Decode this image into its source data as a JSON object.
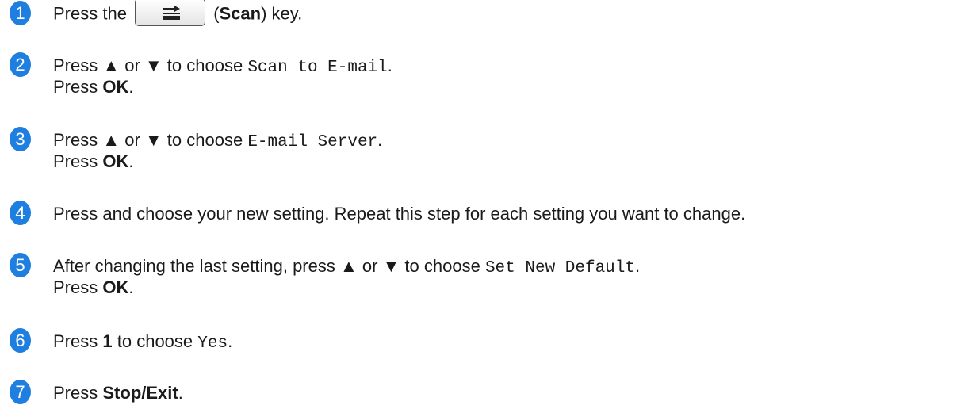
{
  "steps": [
    {
      "number": "1",
      "press_prefix": "Press the",
      "key_name": "Scan",
      "key_suffix": ") key.",
      "open_paren": "(",
      "key_icon": "scan-key-icon"
    },
    {
      "number": "2",
      "line1_prefix": "Press ▲ or ▼ to choose",
      "menu_item": "Scan to E-mail",
      "period": ".",
      "line2_prefix": "Press",
      "key": "OK",
      "line2_suffix": "."
    },
    {
      "number": "3",
      "line1_prefix": "Press ▲ or ▼ to choose",
      "menu_item": "E-mail Server",
      "period": ".",
      "line2_prefix": "Press",
      "key": "OK",
      "line2_suffix": "."
    },
    {
      "number": "4",
      "text": "Press and choose your new setting. Repeat this step for each setting you want to change."
    },
    {
      "number": "5",
      "line1_prefix": "After changing the last setting, press ▲ or ▼ to choose",
      "menu_item": "Set New Default",
      "period": ".",
      "line2_prefix": "Press",
      "key": "OK",
      "line2_suffix": "."
    },
    {
      "number": "6",
      "prefix": "Press",
      "key": "1",
      "middle": "to choose",
      "menu_item": "Yes",
      "period": "."
    },
    {
      "number": "7",
      "prefix": "Press",
      "key": "Stop/Exit",
      "period": "."
    }
  ],
  "colors": {
    "badge": "#1f7fe0",
    "text": "#1a1a1a"
  }
}
